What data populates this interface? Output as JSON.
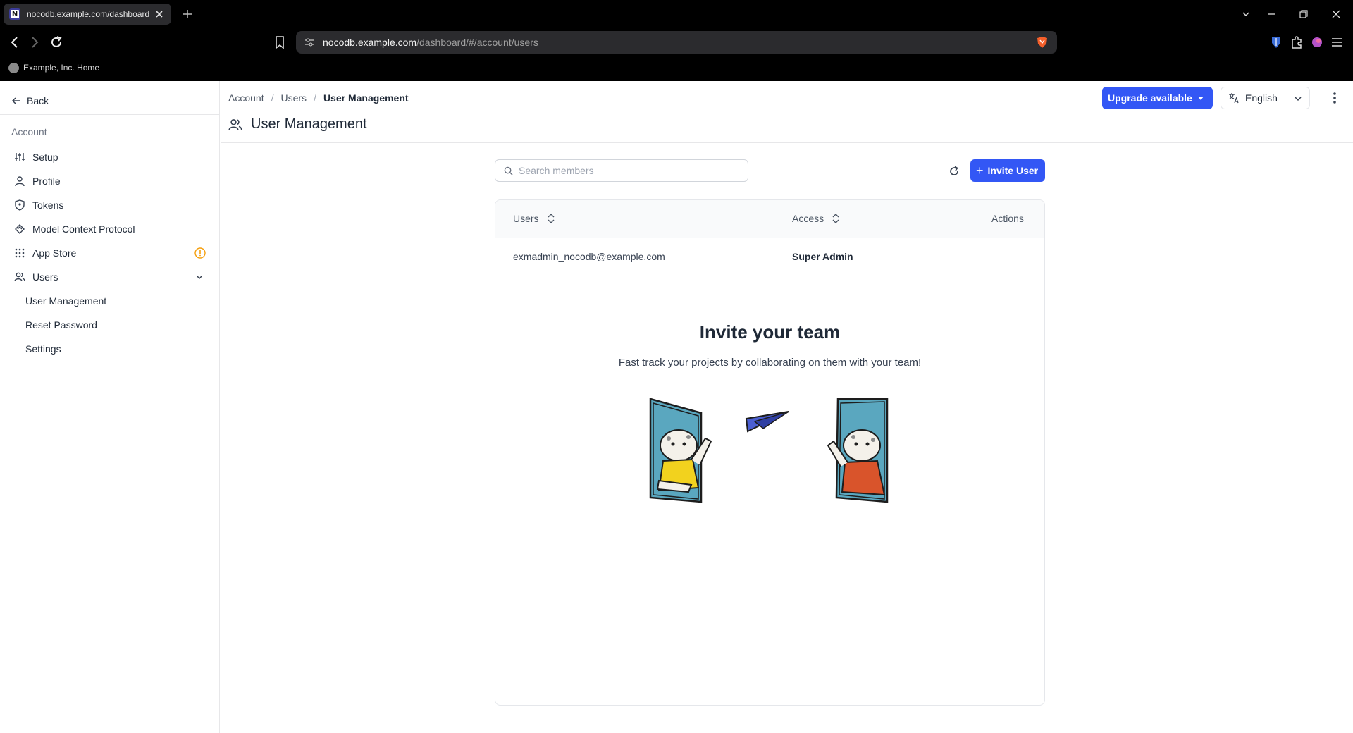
{
  "browser": {
    "tab_title": "nocodb.example.com/dashboard",
    "url_host": "nocodb.example.com",
    "url_path": "/dashboard/#/account/users",
    "bookmark_label": "Example, Inc. Home"
  },
  "sidebar": {
    "back_label": "Back",
    "section_label": "Account",
    "items": [
      {
        "label": "Setup",
        "icon": "sliders-icon"
      },
      {
        "label": "Profile",
        "icon": "user-icon"
      },
      {
        "label": "Tokens",
        "icon": "shield-icon"
      },
      {
        "label": "Model Context Protocol",
        "icon": "mcp-icon"
      },
      {
        "label": "App Store",
        "icon": "grid-icon"
      },
      {
        "label": "Users",
        "icon": "users-icon"
      }
    ],
    "sub_items": [
      "User Management",
      "Reset Password",
      "Settings"
    ]
  },
  "header": {
    "breadcrumb": [
      "Account",
      "Users",
      "User Management"
    ],
    "title": "User Management",
    "upgrade_label": "Upgrade available",
    "language": "English"
  },
  "toolbar": {
    "search_placeholder": "Search members",
    "invite_label": "Invite User"
  },
  "table": {
    "columns": [
      "Users",
      "Access",
      "Actions"
    ],
    "rows": [
      {
        "email": "exmadmin_nocodb@example.com",
        "access": "Super Admin"
      }
    ]
  },
  "empty_state": {
    "title": "Invite your team",
    "subtitle": "Fast track your projects by collaborating on them with your team!"
  },
  "colors": {
    "primary": "#3357f5",
    "warning": "#f59e0b"
  }
}
